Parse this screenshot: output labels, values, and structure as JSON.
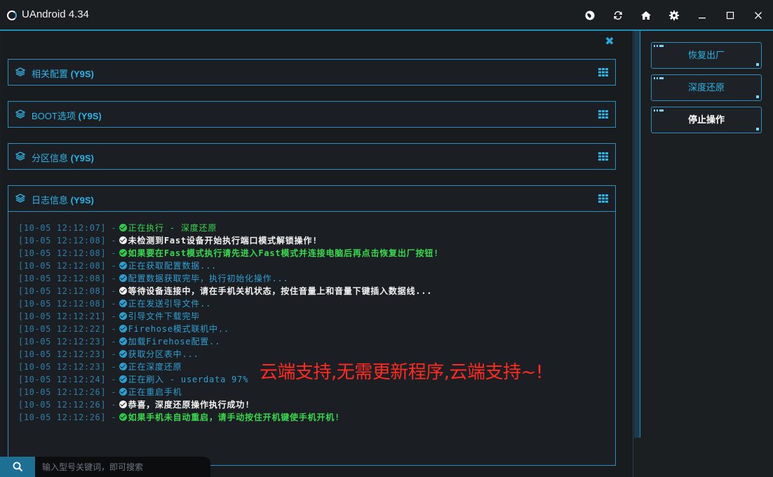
{
  "window": {
    "title": "UAndroid 4.34",
    "buttons": [
      "globe",
      "refresh",
      "home",
      "settings",
      "minimize",
      "maximize",
      "close"
    ]
  },
  "sections": [
    {
      "title": "相关配置",
      "model": "(Y9S)"
    },
    {
      "title": "BOOT选项",
      "model": "(Y9S)"
    },
    {
      "title": "分区信息",
      "model": "(Y9S)"
    }
  ],
  "log_section": {
    "title": "日志信息",
    "model": "(Y9S)"
  },
  "log": [
    {
      "time": "[10-05 12:12:07]",
      "text": "正在执行 - 深度还原",
      "color": "green",
      "bold": false
    },
    {
      "time": "[10-05 12:12:08]",
      "text": "未检测到Fast设备开始执行端口模式解锁操作!",
      "color": "white",
      "bold": true
    },
    {
      "time": "[10-05 12:12:08]",
      "text": "如果要在Fast模式执行请先进入Fast模式并连接电脑后再点击恢复出厂按钮!",
      "color": "green",
      "bold": true
    },
    {
      "time": "[10-05 12:12:08]",
      "text": "正在获取配置数据...",
      "color": "blue",
      "bold": false
    },
    {
      "time": "[10-05 12:12:08]",
      "text": "配置数据获取完毕，执行初始化操作...",
      "color": "blue",
      "bold": false
    },
    {
      "time": "[10-05 12:12:08]",
      "text": "等待设备连接中，请在手机关机状态，按住音量上和音量下键插入数据线...",
      "color": "white",
      "bold": true
    },
    {
      "time": "[10-05 12:12:08]",
      "text": "正在发送引导文件..",
      "color": "blue",
      "bold": false
    },
    {
      "time": "[10-05 12:12:21]",
      "text": "引导文件下载完毕",
      "color": "blue",
      "bold": false
    },
    {
      "time": "[10-05 12:12:22]",
      "text": "Firehose模式联机中..",
      "color": "blue",
      "bold": false
    },
    {
      "time": "[10-05 12:12:23]",
      "text": "加载Firehose配置..",
      "color": "blue",
      "bold": false
    },
    {
      "time": "[10-05 12:12:23]",
      "text": "获取分区表中...",
      "color": "blue",
      "bold": false
    },
    {
      "time": "[10-05 12:12:23]",
      "text": "正在深度还原",
      "color": "blue",
      "bold": false
    },
    {
      "time": "[10-05 12:12:24]",
      "text": "正在刷入 - userdata 97%",
      "color": "blue",
      "bold": false
    },
    {
      "time": "[10-05 12:12:26]",
      "text": "正在重启手机",
      "color": "blue",
      "bold": false
    },
    {
      "time": "[10-05 12:12:26]",
      "text": "恭喜，深度还原操作执行成功!",
      "color": "white",
      "bold": true
    },
    {
      "time": "[10-05 12:12:26]",
      "text": "如果手机未自动重启，请手动按住开机键使手机开机!",
      "color": "green",
      "bold": true
    }
  ],
  "overlay_text": "云端支持,无需更新程序,云端支持~!",
  "actions": [
    {
      "label": "恢复出厂",
      "active": false
    },
    {
      "label": "深度还原",
      "active": false
    },
    {
      "label": "停止操作",
      "active": true
    }
  ],
  "search": {
    "placeholder": "输入型号关键词，即可搜索",
    "value": ""
  },
  "colors": {
    "accent": "#2ab4e8",
    "border": "#2a8fbf",
    "green": "#39d84f",
    "overlay": "#ff2a20"
  }
}
